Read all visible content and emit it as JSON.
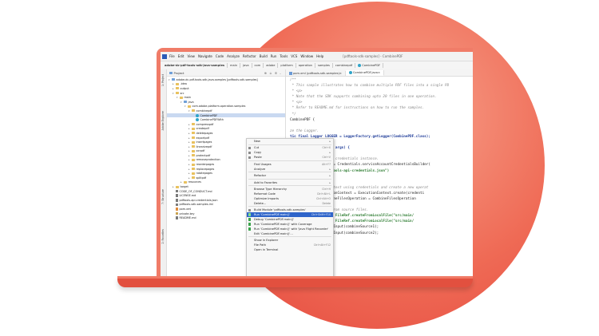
{
  "colors": {
    "accent": "#ef6a55",
    "selection": "#2f65ca"
  },
  "ide": {
    "menu": [
      "File",
      "Edit",
      "View",
      "Navigate",
      "Code",
      "Analyze",
      "Refactor",
      "Build",
      "Run",
      "Tools",
      "VCS",
      "Window",
      "Help"
    ],
    "window_title": "[pdftools-sdk-samples] - CombinePDF",
    "breadcrumbs": [
      "adobe-dc-pdf-tools-sdk-java-samples",
      "main",
      "java",
      "com",
      "adobe",
      "platform",
      "operation",
      "samples",
      "combinepdf"
    ],
    "breadcrumb_file": "CombinePDF",
    "panel_title": "Project",
    "left_strip": [
      "1: Project",
      "Adobe Explorer",
      "7: Structure",
      "2: Favorites"
    ],
    "tabs": [
      "pom.xml (pdftools-sdk-samples)",
      "CombinePDF.java"
    ],
    "tree": [
      {
        "label": "adobe-dc-pdf-tools-sdk-java-samples [pdftools-sdk-samples]",
        "icon": "folder-blue-icon"
      },
      {
        "label": ".idea",
        "icon": "folder-icon"
      },
      {
        "label": "output",
        "icon": "folder-icon"
      },
      {
        "label": "src",
        "icon": "folder-icon"
      },
      {
        "label": "main",
        "icon": "folder-icon"
      },
      {
        "label": "java",
        "icon": "folder-blue-icon"
      },
      {
        "label": "com.adobe.platform.operation.samples",
        "icon": "folder-icon"
      },
      {
        "label": "combinepdf",
        "icon": "folder-icon"
      },
      {
        "label": "CombinePDF",
        "icon": "class-icon"
      },
      {
        "label": "CombinePDFWith",
        "icon": "class-icon"
      },
      {
        "label": "compresspdf",
        "icon": "folder-icon"
      },
      {
        "label": "createpdf",
        "icon": "folder-icon"
      },
      {
        "label": "deletepages",
        "icon": "folder-icon"
      },
      {
        "label": "exportpdf",
        "icon": "folder-icon"
      },
      {
        "label": "insertpages",
        "icon": "folder-icon"
      },
      {
        "label": "linearizepdf",
        "icon": "folder-icon"
      },
      {
        "label": "ocrpdf",
        "icon": "folder-icon"
      },
      {
        "label": "protectpdf",
        "icon": "folder-icon"
      },
      {
        "label": "removeprotection",
        "icon": "folder-icon"
      },
      {
        "label": "reorderpages",
        "icon": "folder-icon"
      },
      {
        "label": "replacepages",
        "icon": "folder-icon"
      },
      {
        "label": "rotatepages",
        "icon": "folder-icon"
      },
      {
        "label": "splitpdf",
        "icon": "folder-icon"
      },
      {
        "label": "resources",
        "icon": "folder-icon"
      },
      {
        "label": "target",
        "icon": "folder-icon"
      },
      {
        "label": "CODE_OF_CONDUCT.md",
        "icon": "file-icon"
      },
      {
        "label": "LICENSE.md",
        "icon": "file-icon"
      },
      {
        "label": "pdftools-api-credentials.json",
        "icon": "file-icon"
      },
      {
        "label": "pdftools-sdk-samples.iml",
        "icon": "file-icon"
      },
      {
        "label": "pom.xml",
        "icon": "xml-icon"
      },
      {
        "label": "private.key",
        "icon": "key-icon"
      },
      {
        "label": "README.md",
        "icon": "file-icon"
      }
    ],
    "context_menu": [
      {
        "label": "New",
        "shortcut": "▸"
      },
      {
        "sep": true
      },
      {
        "label": "Cut",
        "shortcut": "Ctrl+X"
      },
      {
        "label": "Copy",
        "shortcut": "▸"
      },
      {
        "label": "Paste",
        "shortcut": "Ctrl+V"
      },
      {
        "sep": true
      },
      {
        "label": "Find Usages",
        "shortcut": "Alt+F7"
      },
      {
        "label": "Analyze",
        "shortcut": "▸"
      },
      {
        "sep": true
      },
      {
        "label": "Refactor",
        "shortcut": "▸"
      },
      {
        "sep": true
      },
      {
        "label": "Add to Favorites",
        "shortcut": "▸"
      },
      {
        "sep": true
      },
      {
        "label": "Browse Type Hierarchy",
        "shortcut": "Ctrl+H"
      },
      {
        "label": "Reformat Code",
        "shortcut": "Ctrl+Alt+L"
      },
      {
        "label": "Optimize Imports",
        "shortcut": "Ctrl+Alt+O"
      },
      {
        "label": "Delete...",
        "shortcut": "Delete"
      },
      {
        "sep": true
      },
      {
        "label": "Build Module 'pdftools-sdk-samples'",
        "shortcut": ""
      },
      {
        "label": "Run 'CombinePDF.main()'",
        "shortcut": "Ctrl+Shift+F10",
        "highlight": true
      },
      {
        "label": "Debug 'CombinePDF.main()'",
        "shortcut": ""
      },
      {
        "label": "Run 'CombinePDF.main()' with Coverage",
        "shortcut": ""
      },
      {
        "label": "Run 'CombinePDF.main()' with 'Java Flight Recorder'",
        "shortcut": ""
      },
      {
        "label": "Edit 'CombinePDF.main()'...",
        "shortcut": ""
      },
      {
        "sep": true
      },
      {
        "label": "Show in Explorer",
        "shortcut": ""
      },
      {
        "label": "File Path",
        "shortcut": "Ctrl+Alt+F12"
      },
      {
        "label": "Open in Terminal",
        "shortcut": ""
      }
    ],
    "code": [
      {
        "t": "/**",
        "c": "comment"
      },
      {
        "t": " * This sample illustrates how to combine multiple PDF files into a single PD",
        "c": "comment"
      },
      {
        "t": " * <p>",
        "c": "comment"
      },
      {
        "t": " * Note that the SDK supports combining upto 20 files in one operation.",
        "c": "comment"
      },
      {
        "t": " * <p>",
        "c": "comment"
      },
      {
        "t": " * Refer to README.md for instructions on how to run the samples.",
        "c": "comment"
      },
      {
        "t": " */",
        "c": "comment"
      },
      {
        "t": "CombinePDF {",
        "c": ""
      },
      {
        "t": "",
        "c": ""
      },
      {
        "t": "ze the Logger.",
        "c": "comment"
      },
      {
        "t": "tic final Logger LOGGER = LoggerFactory.getLogger(CombinePDF.class);",
        "c": "keyword"
      },
      {
        "t": "",
        "c": ""
      },
      {
        "t": "ic void main(String[] args) {",
        "c": "keyword"
      },
      {
        "t": "",
        "c": ""
      },
      {
        "t": "Initial setup, create credentials instance.",
        "c": "comment"
      },
      {
        "t": "dentials credentials = Credentials.serviceAccountCredentialsBuilder(",
        "c": ""
      },
      {
        "t": "      .fromFile(\"pdftools-api-credentials.json\")",
        "c": "str"
      },
      {
        "t": "      .build();",
        "c": ""
      },
      {
        "t": "",
        "c": ""
      },
      {
        "t": "reate an ExecutionContext using credentials and create a new operat",
        "c": "comment"
      },
      {
        "t": "cutionContext executionContext = ExecutionContext.create(credenti",
        "c": ""
      },
      {
        "t": "eFilesOperation combineFilesOperation = CombineFilesOperation",
        "c": ""
      },
      {
        "t": "",
        "c": ""
      },
      {
        "t": "Add operation input from source files.",
        "c": "comment"
      },
      {
        "t": "eRef combineSource1 = FileRef.createFromLocalFile(\"src/main/",
        "c": "str"
      },
      {
        "t": "eRef combineSource2 = FileRef.createFromLocalFile(\"src/main/",
        "c": "str"
      },
      {
        "t": "ineFilesOperation.addInput(combineSource1);",
        "c": ""
      },
      {
        "t": "ineFilesOperation.addInput(combineSource2);",
        "c": ""
      }
    ]
  }
}
